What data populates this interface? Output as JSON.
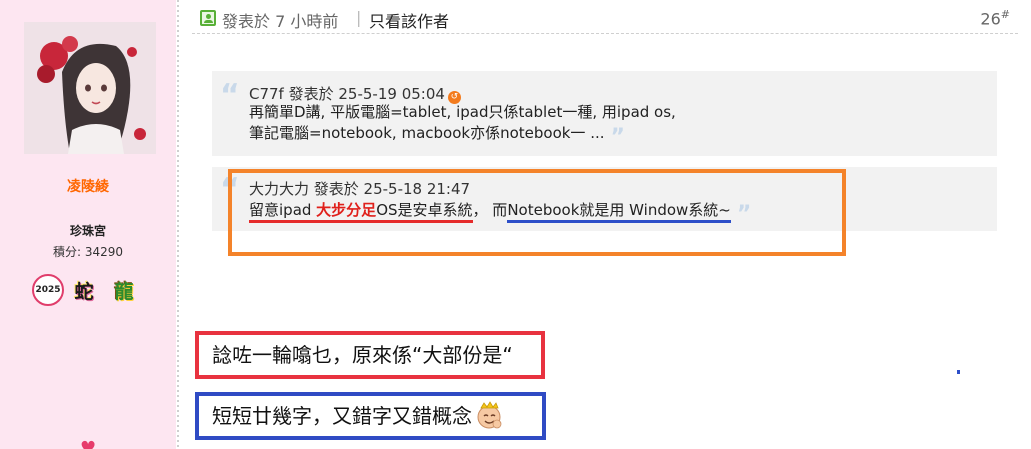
{
  "user": {
    "name": "凌陵綾",
    "rank": "珍珠宮",
    "points_label": "積分: 34290",
    "medals": [
      "2025",
      "蛇",
      "龍"
    ]
  },
  "post": {
    "posted": "發表於 7 小時前",
    "separator": "|",
    "author_only": "只看該作者",
    "floor": "26",
    "floor_mark": "#"
  },
  "quotes": [
    {
      "author": "C77f 發表於 25-5-19 05:04",
      "lines": [
        "再簡單D講, 平版電腦=tablet, ipad只係tablet一種, 用ipad os,",
        "筆記電腦=notebook, macbook亦係notebook一 ..."
      ]
    },
    {
      "author": "大力大力 發表於 25-5-18 21:47",
      "part1": "留意ipad ",
      "part_bold": "大步分足",
      "part2": "OS是安卓系統",
      "part3": "， 而",
      "part4": "Notebook就是用 Window系統~"
    }
  ],
  "reply": {
    "line1": "諗咗一輪噏乜，原來係“大部份是“",
    "line2": "短短廿幾字，又錯字又錯概念"
  },
  "colors": {
    "username": "#ff6600",
    "red_box": "#e8323f",
    "blue_box": "#2f4bc4",
    "orange_box": "#f4832a",
    "sidebar_bg": "#fde6f1"
  },
  "icons": [
    "online-status-icon",
    "jump-to-post-icon",
    "quote-open-icon",
    "quote-close-icon",
    "smiley-crown-icon",
    "heart-icon"
  ]
}
